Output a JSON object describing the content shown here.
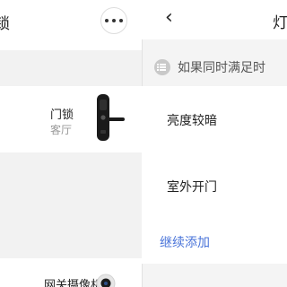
{
  "left_panel": {
    "title": "锁",
    "more_icon": "more-horizontal-icon",
    "devices": [
      {
        "name": "门锁",
        "room": "客厅",
        "icon": "door-lock-image"
      },
      {
        "name": "网关摄像机",
        "room": "",
        "icon": "camera-image"
      }
    ]
  },
  "right_panel": {
    "back_icon": "chevron-left-icon",
    "title": "灯",
    "conditions_header": "如果同时满足时",
    "conditions": [
      "亮度较暗",
      "室外开门"
    ],
    "add_more": "继续添加"
  },
  "colors": {
    "background": "#f2f2f2",
    "card": "#ffffff",
    "link": "#4a74d9"
  }
}
